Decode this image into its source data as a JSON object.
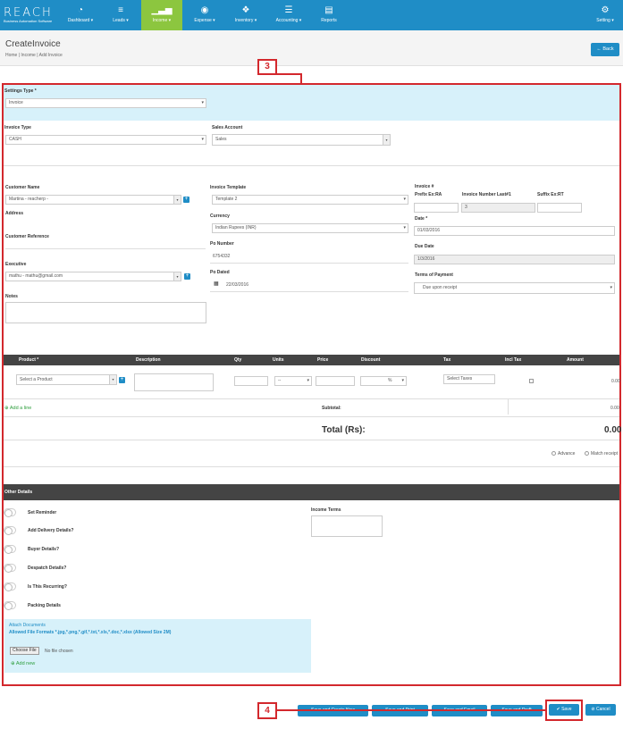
{
  "topnav": {
    "logo": "REACH",
    "tagline": "Business Automation Software",
    "items": [
      {
        "label": "Dashboard ▾",
        "icon": "◔"
      },
      {
        "label": "Leads ▾",
        "icon": "≡"
      },
      {
        "label": "Income ▾",
        "icon": "▁▃▅"
      },
      {
        "label": "Expense ▾",
        "icon": "◉"
      },
      {
        "label": "Inventory ▾",
        "icon": "❖"
      },
      {
        "label": "Accounting ▾",
        "icon": "☰"
      },
      {
        "label": "Reports",
        "icon": "▤"
      }
    ],
    "setting": "Setting ▾",
    "setting_icon": "⚙"
  },
  "header": {
    "title": "CreateInvoice",
    "breadcrumb": "Home  |  Income  |  Add Invoice",
    "back": "← Back"
  },
  "callouts": {
    "form": "3",
    "save": "4"
  },
  "form": {
    "settings_type_label": "Settings Type *",
    "settings_type_value": "Invoice",
    "invoice_type_label": "Invoice Type",
    "invoice_type_value": "CASH",
    "sales_account_label": "Sales Account",
    "sales_account_value": "Sales",
    "customer_name_label": "Customer Name",
    "customer_name_value": "Martina - reacherp -",
    "address_label": "Address",
    "customer_reference_label": "Customer Reference",
    "executive_label": "Executive",
    "executive_value": "mathu - mathu@gmail.com",
    "notes_label": "Notes",
    "invoice_template_label": "Invoice Template",
    "invoice_template_value": "Template 2",
    "currency_label": "Currency",
    "currency_value": "Indian Rupees (INR)",
    "po_number_label": "Po Number",
    "po_number_value": "6754332",
    "po_dated_label": "Po Dated",
    "po_dated_value": "22/03/2016",
    "invoice_no_label": "Invoice #",
    "prefix_label": "Prefix Ex:RA",
    "invoice_number_label": "Invoice Number Last#1",
    "suffix_label": "Suffix Ex:RT",
    "invoice_number_value": "3",
    "date_label": "Date *",
    "date_value": "01/03/2016",
    "due_date_label": "Due Date",
    "due_date_value": "1/3/2016",
    "terms_label": "Terms of Payment",
    "terms_value": "Due upon receipt"
  },
  "table": {
    "headers": [
      "Product *",
      "Description",
      "Qty",
      "Units",
      "Price",
      "Discount",
      "Tax",
      "Incl Tax",
      "Amount"
    ],
    "product_placeholder": "Select a Product",
    "units_value": "--",
    "discount_unit": "%",
    "tax_placeholder": "Select Taxes",
    "row_amount": "0.00",
    "add_line": "Add a line",
    "subtotal_label": "Subtotal:",
    "subtotal_value": "0.00",
    "total_label": "Total (Rs):",
    "total_value": "0.00",
    "advance": "Advance",
    "match_receipt": "Match receipt"
  },
  "other": {
    "header": "Other Details",
    "toggles": [
      "Set Reminder",
      "Add Delivery Details?",
      "Buyer Details?",
      "Despatch Details?",
      "Is This Recurring?",
      "Packing Details"
    ],
    "income_terms_label": "Income Terms",
    "attach_title": "Attach Documents",
    "attach_formats": "Allowed File Formats *.jpg,*.png,*.gif,*.txt,*.xls,*.doc,*.xlsx (Allowed Size 2M)",
    "choose_file": "Choose File",
    "no_file": "No file chosen",
    "add_new": "Add new"
  },
  "footer": {
    "buttons": [
      "Save and Create New",
      "Save and Print",
      "Save and Email",
      "Save and Draft"
    ],
    "save": "✔ Save",
    "cancel": "⊘ Cancel"
  }
}
